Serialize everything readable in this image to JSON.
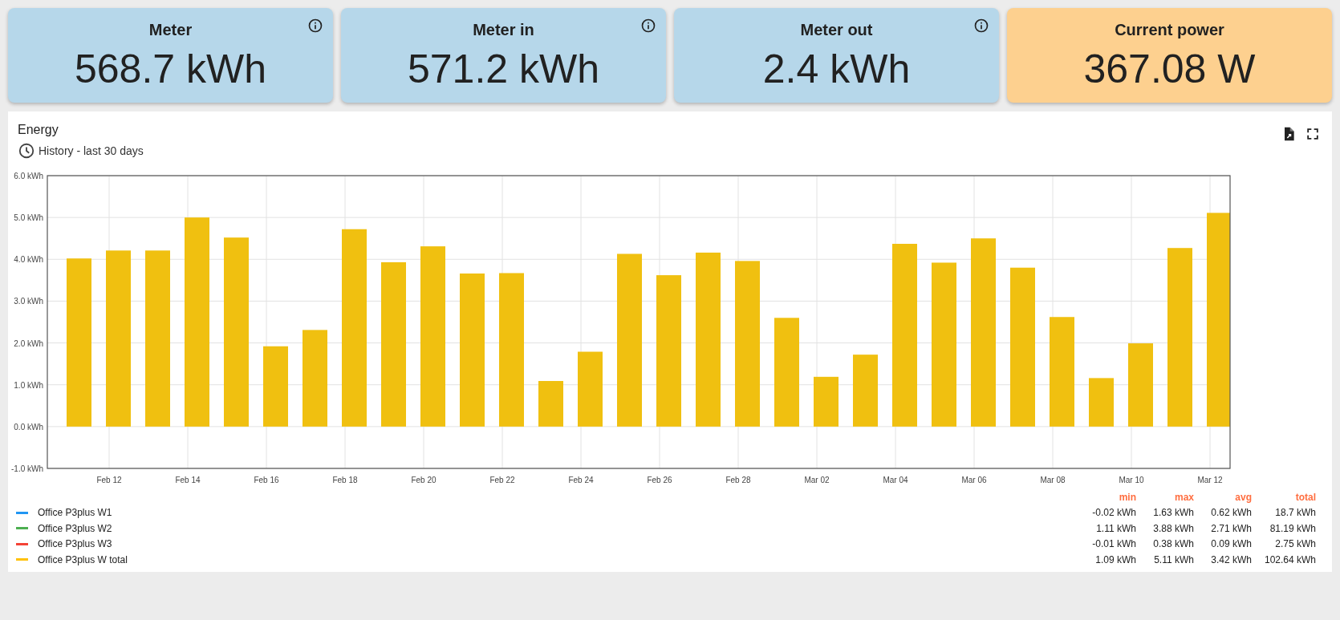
{
  "cards": [
    {
      "title": "Meter",
      "value": "568.7 kWh",
      "info": true,
      "color": "#b6d7ea"
    },
    {
      "title": "Meter in",
      "value": "571.2 kWh",
      "info": true,
      "color": "#b6d7ea"
    },
    {
      "title": "Meter out",
      "value": "2.4 kWh",
      "info": true,
      "color": "#b6d7ea"
    },
    {
      "title": "Current power",
      "value": "367.08 W",
      "info": false,
      "color": "#fdd08f"
    }
  ],
  "energy": {
    "title": "Energy",
    "subtitle": "History - last 30 days",
    "chart_data": {
      "type": "bar",
      "grid": true,
      "categories": [
        null,
        "Feb 12",
        null,
        "Feb 14",
        null,
        "Feb 16",
        null,
        "Feb 18",
        null,
        "Feb 20",
        null,
        "Feb 22",
        null,
        "Feb 24",
        null,
        "Feb 26",
        null,
        "Feb 28",
        null,
        "Mar 02",
        null,
        "Mar 04",
        null,
        "Mar 06",
        null,
        "Mar 08",
        null,
        "Mar 10",
        null,
        "Mar 12"
      ],
      "series": [
        {
          "color": "#f0c010",
          "values": [
            4.02,
            4.21,
            4.21,
            5.0,
            4.52,
            1.92,
            2.31,
            4.72,
            3.93,
            4.31,
            3.66,
            3.67,
            1.09,
            1.79,
            4.13,
            3.62,
            4.16,
            3.96,
            2.6,
            1.19,
            1.72,
            4.37,
            3.92,
            4.5,
            3.8,
            2.62,
            1.16,
            1.99,
            4.27,
            5.11
          ]
        }
      ],
      "ylim": [
        -1,
        6
      ],
      "yticks": [
        {
          "value": 6,
          "label": "6.0 kWh"
        },
        {
          "value": 5,
          "label": "5.0 kWh"
        },
        {
          "value": 4,
          "label": "4.0 kWh"
        },
        {
          "value": 3,
          "label": "3.0 kWh"
        },
        {
          "value": 2,
          "label": "2.0 kWh"
        },
        {
          "value": 1,
          "label": "1.0 kWh"
        },
        {
          "value": 0,
          "label": "0.0 kWh"
        },
        {
          "value": -1,
          "label": "-1.0 kWh"
        }
      ]
    },
    "legend": {
      "columns": [
        "min",
        "max",
        "avg",
        "total"
      ],
      "items": [
        {
          "name": "Office P3plus W1",
          "color": "#2196f3",
          "values": [
            "-0.02 kWh",
            "1.63 kWh",
            "0.62 kWh",
            "18.7 kWh"
          ]
        },
        {
          "name": "Office P3plus W2",
          "color": "#4caf50",
          "values": [
            "1.11 kWh",
            "3.88 kWh",
            "2.71 kWh",
            "81.19 kWh"
          ]
        },
        {
          "name": "Office P3plus W3",
          "color": "#f44336",
          "values": [
            "-0.01 kWh",
            "0.38 kWh",
            "0.09 kWh",
            "2.75 kWh"
          ]
        },
        {
          "name": "Office P3plus W total",
          "color": "#ffc107",
          "values": [
            "1.09 kWh",
            "5.11 kWh",
            "3.42 kWh",
            "102.64 kWh"
          ]
        }
      ]
    }
  }
}
